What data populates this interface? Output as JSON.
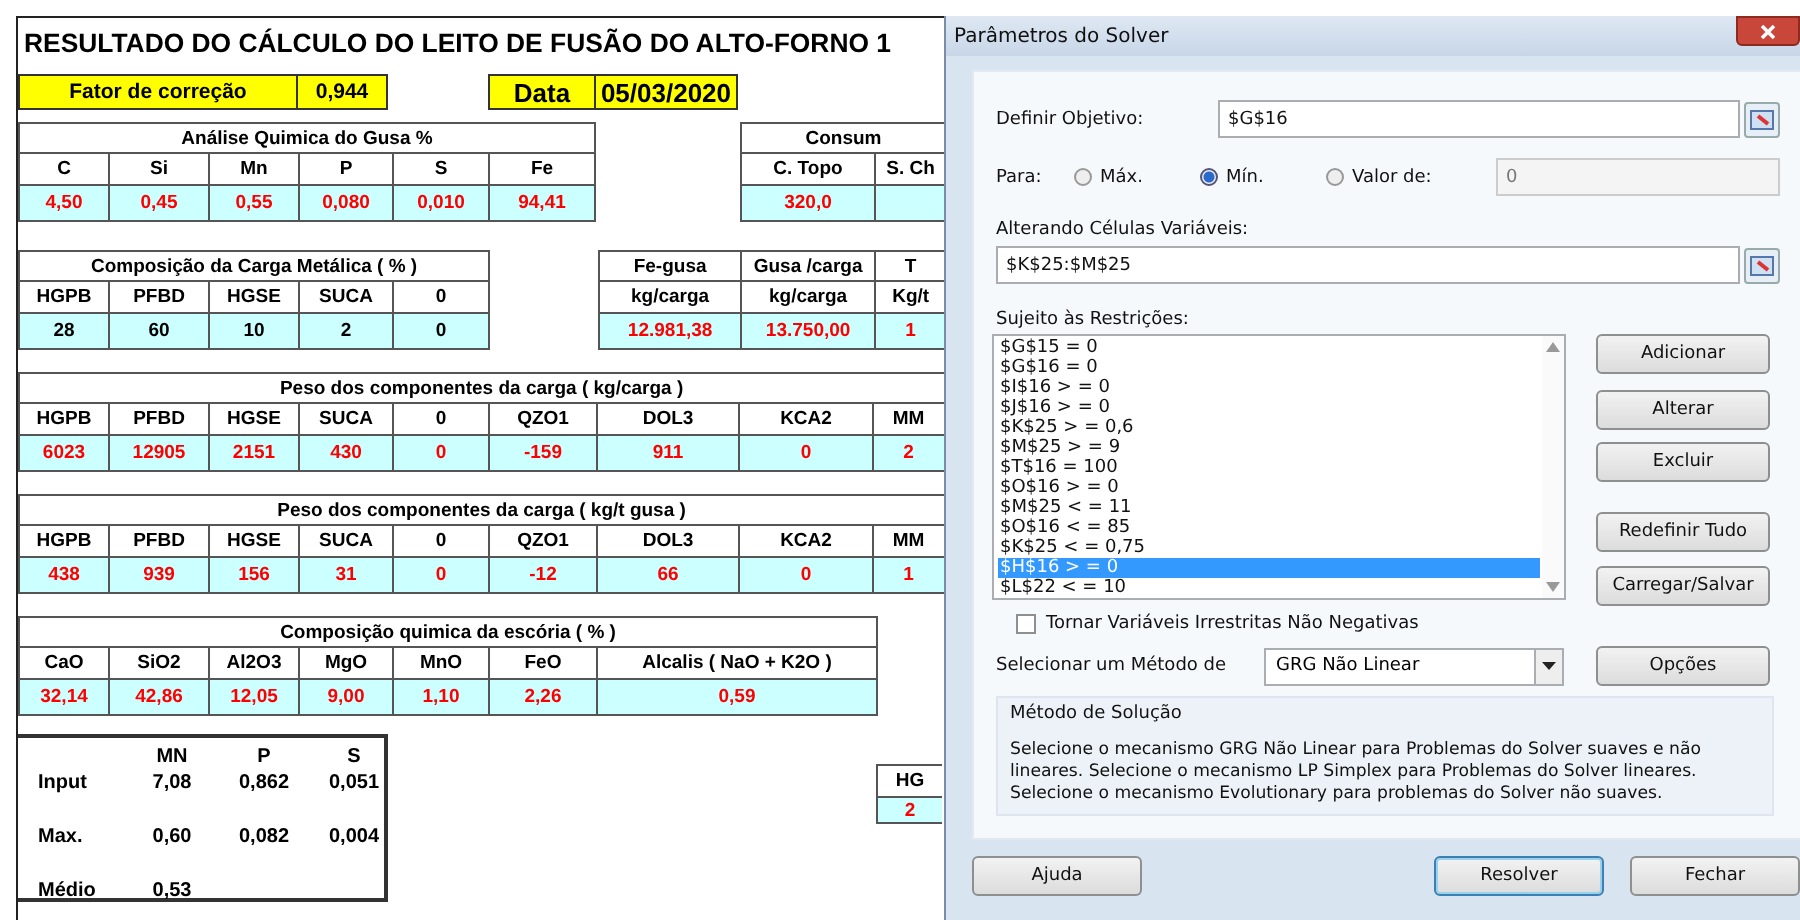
{
  "sheet": {
    "title": "RESULTADO DO CÁLCULO DO LEITO DE FUSÃO DO ALTO-FORNO 1",
    "fields": [
      {
        "label": "Fator de correção",
        "value": "0,944"
      },
      {
        "label": "Data",
        "value": "05/03/2020"
      }
    ],
    "table_rows": [
      [
        {
          "kind": "result",
          "title": "Análise Quimica do Gusa %",
          "headers": [
            "C",
            "Si",
            "Mn",
            "P",
            "S",
            "Fe"
          ],
          "values": [
            "4,50",
            "0,45",
            "0,55",
            "0,080",
            "0,010",
            "94,41"
          ]
        },
        {
          "kind": "result",
          "title": "Consum",
          "headers": [
            "C. Topo",
            "S. Ch"
          ],
          "values": [
            "320,0"
          ]
        }
      ],
      [
        {
          "kind": "input",
          "title": "Composição da Carga Metálica ( % )",
          "headers": [
            "HGPB",
            "PFBD",
            "HGSE",
            "SUCA",
            "0"
          ],
          "values": [
            "28",
            "60",
            "10",
            "2",
            "0"
          ]
        },
        {
          "kind": "result",
          "headers": [
            "Fe-gusa",
            "Gusa /carga",
            "T"
          ],
          "units": [
            "kg/carga",
            "kg/carga",
            "Kg/t"
          ],
          "values": [
            "12.981,38",
            "13.750,00",
            "1"
          ]
        }
      ],
      [
        {
          "kind": "result",
          "title": "Peso dos componentes da carga ( kg/carga )",
          "headers": [
            "HGPB",
            "PFBD",
            "HGSE",
            "SUCA",
            "0",
            "QZO1",
            "DOL3",
            "KCA2",
            "MM"
          ],
          "values": [
            "6023",
            "12905",
            "2151",
            "430",
            "0",
            "-159",
            "911",
            "0",
            "2"
          ]
        }
      ],
      [
        {
          "kind": "result",
          "title": "Peso dos componentes da carga ( kg/t gusa )",
          "headers": [
            "HGPB",
            "PFBD",
            "HGSE",
            "SUCA",
            "0",
            "QZO1",
            "DOL3",
            "KCA2",
            "MM"
          ],
          "values": [
            "438",
            "939",
            "156",
            "31",
            "0",
            "-12",
            "66",
            "0",
            "1"
          ]
        }
      ],
      [
        {
          "kind": "result",
          "title": "Composição quimica da escória ( % )",
          "headers": [
            "CaO",
            "SiO2",
            "Al2O3",
            "MgO",
            "MnO",
            "FeO",
            "Alcalis ( NaO + K2O )"
          ],
          "values": [
            "32,14",
            "42,86",
            "12,05",
            "9,00",
            "1,10",
            "2,26",
            "0,59"
          ]
        }
      ]
    ],
    "limits": {
      "columns": [
        "MN",
        "P",
        "S"
      ],
      "rows": [
        {
          "label": "Input",
          "values": [
            "7,08",
            "0,862",
            "0,051"
          ]
        },
        {
          "label": "Max.",
          "values": [
            "0,60",
            "0,082",
            "0,004"
          ]
        },
        {
          "label": "Médio",
          "values": [
            "0,53"
          ]
        }
      ]
    },
    "side_table": {
      "headers": [
        "HG"
      ],
      "values": [
        "2"
      ]
    }
  },
  "dialog": {
    "title": "Parâmetros do Solver",
    "objective": {
      "label": "Definir Objetivo:",
      "value": "$G$16"
    },
    "to": {
      "label": "Para:",
      "options": [
        {
          "label": "Máx.",
          "selected": false
        },
        {
          "label": "Mín.",
          "selected": true
        },
        {
          "label": "Valor de:",
          "selected": false
        }
      ],
      "value": "0"
    },
    "changing": {
      "label": "Alterando Células Variáveis:",
      "value": "$K$25:$M$25"
    },
    "constraints": {
      "label": "Sujeito às Restrições:",
      "items": [
        {
          "text": "$G$15 = 0",
          "selected": false
        },
        {
          "text": "$G$16 = 0",
          "selected": false
        },
        {
          "text": "$I$16 > = 0",
          "selected": false
        },
        {
          "text": "$J$16 > = 0",
          "selected": false
        },
        {
          "text": "$K$25 > = 0,6",
          "selected": false
        },
        {
          "text": "$M$25 > = 9",
          "selected": false
        },
        {
          "text": "$T$16 = 100",
          "selected": false
        },
        {
          "text": "$O$16 > = 0",
          "selected": false
        },
        {
          "text": "$M$25 < = 11",
          "selected": false
        },
        {
          "text": "$O$16 < = 85",
          "selected": false
        },
        {
          "text": "$K$25 < = 0,75",
          "selected": false
        },
        {
          "text": "$H$16 > = 0",
          "selected": true
        },
        {
          "text": "$L$22 < = 10",
          "selected": false
        }
      ]
    },
    "list_buttons": [
      "Adicionar",
      "Alterar",
      "Excluir",
      "Redefinir Tudo",
      "Carregar/Salvar"
    ],
    "nonnegative": {
      "label": "Tornar Variáveis Irrestritas Não Negativas",
      "checked": false
    },
    "method": {
      "label": "Selecionar um Método de",
      "value": "GRG Não Linear",
      "button": "Opções"
    },
    "solution": {
      "title": "Método de Solução",
      "text": "Selecione o mecanismo GRG Não Linear para Problemas do Solver suaves e não lineares. Selecione o mecanismo LP Simplex para Problemas do Solver lineares. Selecione o mecanismo Evolutionary para problemas do Solver não suaves."
    },
    "buttons": [
      {
        "label": "Ajuda",
        "focused": false
      },
      {
        "label": "Resolver",
        "focused": true
      },
      {
        "label": "Fechar",
        "focused": false
      }
    ]
  }
}
